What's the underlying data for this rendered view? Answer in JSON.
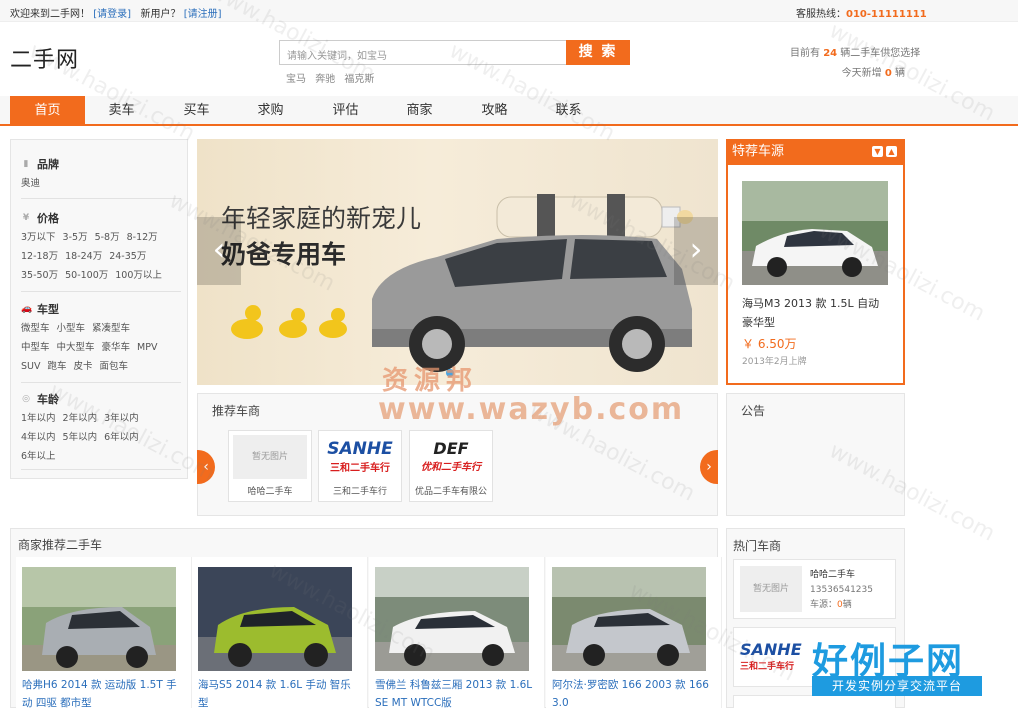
{
  "topbar": {
    "welcome": "欢迎来到二手网！",
    "login": "[请登录]",
    "new_user": "新用户？",
    "register": "[请注册]",
    "hotline_label": "客服热线：",
    "hotline": "010-11111111"
  },
  "header": {
    "logo": "二手网",
    "search_placeholder": "请输入关键词，如宝马",
    "search_button": "搜 索",
    "hot_words": [
      "宝马",
      "奔驰",
      "福克斯"
    ],
    "stat_prefix": "目前有",
    "stat_count": "24",
    "stat_suffix": "辆二手车供您选择",
    "today_prefix": "今天新增",
    "today_count": "0",
    "today_suffix": "辆"
  },
  "nav": {
    "items": [
      "首页",
      "卖车",
      "买车",
      "求购",
      "评估",
      "商家",
      "攻略",
      "联系"
    ],
    "active": "首页"
  },
  "filter": {
    "brand": {
      "title": "品牌",
      "options": [
        "奥迪"
      ]
    },
    "price": {
      "title": "价格",
      "options": [
        "3万以下",
        "3-5万",
        "5-8万",
        "8-12万",
        "12-18万",
        "18-24万",
        "24-35万",
        "35-50万",
        "50-100万",
        "100万以上"
      ]
    },
    "type": {
      "title": "车型",
      "options": [
        "微型车",
        "小型车",
        "紧凑型车",
        "中型车",
        "中大型车",
        "豪华车",
        "MPV",
        "SUV",
        "跑车",
        "皮卡",
        "面包车"
      ]
    },
    "age": {
      "title": "车龄",
      "options": [
        "1年以内",
        "2年以内",
        "3年以内",
        "4年以内",
        "5年以内",
        "6年以内",
        "6年以上"
      ]
    }
  },
  "banner": {
    "line1": "年轻家庭的新宠儿",
    "line2": "奶爸专用车"
  },
  "featured": {
    "title": "特荐车源",
    "car_title": "海马M3 2013 款 1.5L 自动 豪华型",
    "price": "￥ 6.50万",
    "date": "2013年2月上牌"
  },
  "dealers": {
    "title": "推荐车商",
    "items": [
      {
        "name": "哈哈二手车",
        "img": "暂无图片"
      },
      {
        "name": "三和二手车行",
        "logo_text": "SANHE",
        "logo_sub": "三和二手车行"
      },
      {
        "name": "优品二手车有限公",
        "logo_text": "DEF",
        "logo_sub": "优和二手车行"
      }
    ]
  },
  "notice": {
    "title": "公告"
  },
  "recommended": {
    "title": "商家推荐二手车",
    "cars": [
      {
        "title": "哈弗H6 2014 款 运动版 1.5T 手动 四驱 都市型"
      },
      {
        "title": "海马S5 2014 款 1.6L 手动 智乐型"
      },
      {
        "title": "雪佛兰 科鲁兹三厢 2013 款 1.6L SE MT WTCC版"
      },
      {
        "title": "阿尔法·罗密欧 166 2003 款 166 3.0"
      }
    ]
  },
  "hot_dealers": {
    "title": "热门车商",
    "items": [
      {
        "img": "暂无图片",
        "name": "哈哈二手车",
        "phone": "13536541235",
        "stock_label": "车源：",
        "stock": "0",
        "stock_unit": "辆"
      }
    ],
    "second_logo": "SANHE",
    "second_logo_sub": "三和二手车行"
  },
  "watermarks": {
    "site": "www.haolizi.com",
    "resource": "资源邦",
    "url": "www.wazyb.com",
    "brand": "好例子网",
    "brand_sub": "开发实例分享交流平台"
  },
  "colors": {
    "accent": "#f26b1d",
    "link": "#2a6ebb",
    "panel": "#f8f8f8"
  }
}
